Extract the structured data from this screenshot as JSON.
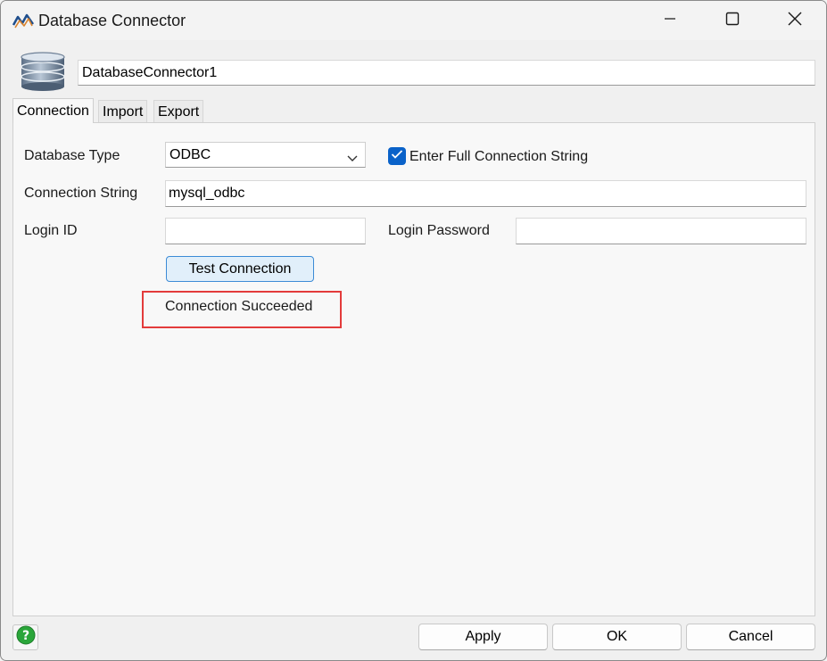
{
  "window": {
    "title": "Database Connector",
    "icons": {
      "app": "app-logo-icon",
      "minimize": "minimize-icon",
      "maximize": "maximize-icon",
      "close": "close-icon"
    }
  },
  "header": {
    "icon": "database-icon",
    "connector_name": "DatabaseConnector1"
  },
  "tabs": [
    {
      "label": "Connection",
      "active": true
    },
    {
      "label": "Import",
      "active": false
    },
    {
      "label": "Export",
      "active": false
    }
  ],
  "connection": {
    "database_type_label": "Database Type",
    "database_type_value": "ODBC",
    "full_string_checkbox_label": "Enter Full Connection String",
    "full_string_checked": true,
    "connection_string_label": "Connection String",
    "connection_string_value": "mysql_odbc",
    "login_id_label": "Login ID",
    "login_id_value": "",
    "login_password_label": "Login Password",
    "login_password_value": "",
    "test_button_label": "Test Connection",
    "status_text": "Connection Succeeded"
  },
  "footer": {
    "help_icon": "help-icon",
    "apply_label": "Apply",
    "ok_label": "OK",
    "cancel_label": "Cancel"
  },
  "colors": {
    "accent": "#0a62c9",
    "highlight_border": "#e33b3b",
    "test_button_bg": "#e1effa",
    "help_icon_green": "#2aa63a"
  }
}
